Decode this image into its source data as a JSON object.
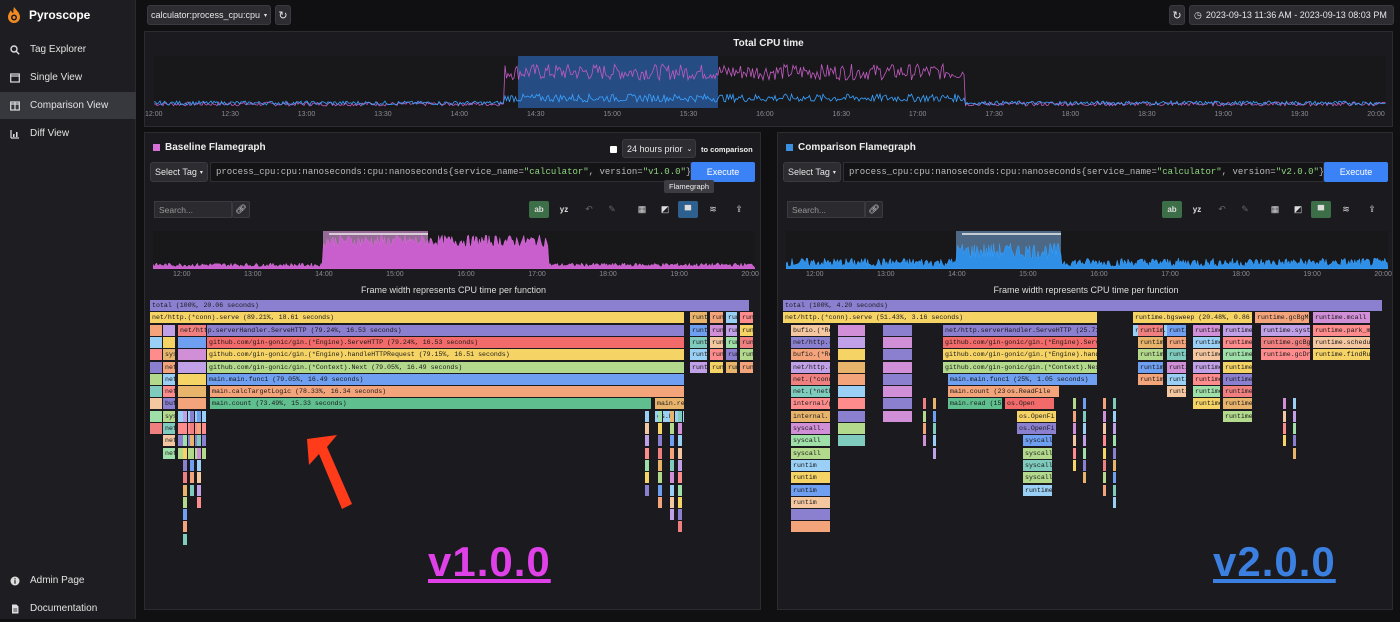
{
  "app": {
    "name": "Pyroscope"
  },
  "sidebar": {
    "items": [
      {
        "label": "Tag Explorer",
        "icon": "search-icon",
        "active": false
      },
      {
        "label": "Single View",
        "icon": "window-icon",
        "active": false
      },
      {
        "label": "Comparison View",
        "icon": "columns-icon",
        "active": true
      },
      {
        "label": "Diff View",
        "icon": "chart-icon",
        "active": false
      }
    ],
    "bottom": [
      {
        "label": "Admin Page",
        "icon": "info-icon"
      },
      {
        "label": "Documentation",
        "icon": "document-icon"
      }
    ]
  },
  "topbar": {
    "app_selector": "calculator:process_cpu:cpu",
    "date_range": "2023-09-13 11:36 AM - 2023-09-13 08:03 PM"
  },
  "main_timeline": {
    "title": "Total CPU time",
    "ticks": [
      "12:00",
      "12:30",
      "13:00",
      "13:30",
      "14:00",
      "14:30",
      "15:00",
      "15:30",
      "16:00",
      "16:30",
      "17:00",
      "17:30",
      "18:00",
      "18:30",
      "19:00",
      "19:30",
      "20:00"
    ]
  },
  "baseline": {
    "title": "Baseline Flamegraph",
    "color": "#d66fd6",
    "sync_select": "24 hours prior",
    "sync_label": "to comparison",
    "select_tag": "Select Tag",
    "query_prefix": "process_cpu:cpu:nanoseconds:cpu:nanoseconds{",
    "query_k1": "service_name=",
    "query_v1": "\"calculator\"",
    "query_sep": ", ",
    "query_k2": "version=",
    "query_v2": "\"v1.0.0\"",
    "query_suffix": "}",
    "execute": "Execute",
    "search_placeholder": "Search...",
    "tooltip": "Flamegraph",
    "ticks": [
      "12:00",
      "13:00",
      "14:00",
      "15:00",
      "16:00",
      "17:00",
      "18:00",
      "19:00",
      "20:00"
    ],
    "subtitle": "Frame width represents CPU time per function",
    "version_label": "v1.0.0",
    "frames": [
      {
        "label": "total (100%, 20.06 seconds)"
      },
      {
        "label": "net/http.(*conn).serve (89.21%, 18.61 seconds)"
      },
      {
        "label": "net/http.serverHandler.ServeHTTP (79.24%, 16.53 seconds)"
      },
      {
        "label": "github.com/gin-gonic/gin.(*Engine).ServeHTTP (79.24%, 16.53 seconds)"
      },
      {
        "label": "github.com/gin-gonic/gin.(*Engine).handleHTTPRequest (79.15%, 16.51 seconds)"
      },
      {
        "label": "github.com/gin-gonic/gin.(*Context).Next (79.05%, 16.49 seconds)"
      },
      {
        "label": "main.main.func1 (79.05%, 16.49 seconds)"
      },
      {
        "label": "main.calcTargetLogic (78.33%, 16.34 seconds)"
      },
      {
        "label": "main.count (73.49%, 15.33 seconds)"
      }
    ],
    "side_labels": [
      "runtime",
      "runt",
      "runt",
      "runt",
      "runt",
      "net",
      "net/http",
      "net",
      "bufio",
      "syscall",
      "interna",
      "sysca",
      "main.re",
      "os.R"
    ]
  },
  "comparison": {
    "title": "Comparison Flamegraph",
    "color": "#3b8fe0",
    "select_tag": "Select Tag",
    "query_prefix": "process_cpu:cpu:nanoseconds:cpu:nanoseconds{",
    "query_k1": "service_name=",
    "query_v1": "\"calculator\"",
    "query_sep": ", ",
    "query_k2": "version=",
    "query_v2": "\"v2.0.0\"",
    "query_suffix": "}",
    "execute": "Execute",
    "search_placeholder": "Search...",
    "ticks": [
      "12:00",
      "13:00",
      "14:00",
      "15:00",
      "16:00",
      "17:00",
      "18:00",
      "19:00",
      "20:00"
    ],
    "subtitle": "Frame width represents CPU time per function",
    "version_label": "v2.0.0",
    "frames": [
      {
        "label": "total (100%, 4.20 seconds)"
      },
      {
        "label": "net/http.(*conn).serve (51.43%, 3.16 seconds)"
      },
      {
        "label": "net/http.serverHandler.ServeHTTP (25.71%"
      },
      {
        "label": "github.com/gin-gonic/gin.(*Engine).Serve"
      },
      {
        "label": "github.com/gin-gonic/gin.(*Engine).handl"
      },
      {
        "label": "github.com/gin-gonic/gin.(*Context).Next"
      },
      {
        "label": "main.main.func1 (25%, 1.05 seconds)"
      },
      {
        "label": "main.count (23.81%, 1.00 sec"
      },
      {
        "label": "main.read (15.71%, 0.66"
      },
      {
        "label": "os.ReadFile"
      },
      {
        "label": "os.Open"
      },
      {
        "label": "os.OpenFi"
      },
      {
        "label": "os.OpenFi"
      },
      {
        "label": "syscall"
      },
      {
        "label": "syscall"
      },
      {
        "label": "syscall"
      },
      {
        "label": "syscall"
      },
      {
        "label": "runtime."
      }
    ],
    "runtime_labels": [
      "runtime.bgsweep (20.48%, 0.86 se",
      "runtime.gcBgMar",
      "runtime.mcall",
      "runtime.freeSo",
      "runtime.syste",
      "runtime.park_m",
      "runtime.gcBgM",
      "runtime.schedu",
      "runtime.gcDra",
      "runtime.findRu"
    ],
    "left_labels": [
      "bufio.(*Rea",
      "net/http.(*resp",
      "bufio.(*Rea",
      "net/http.(",
      "net.(*conn",
      "net.(*netF",
      "internal/p",
      "internal.",
      "syscall.",
      "syscall",
      "syscall",
      "runtim",
      "runtim",
      "runtim",
      "runtim"
    ]
  }
}
